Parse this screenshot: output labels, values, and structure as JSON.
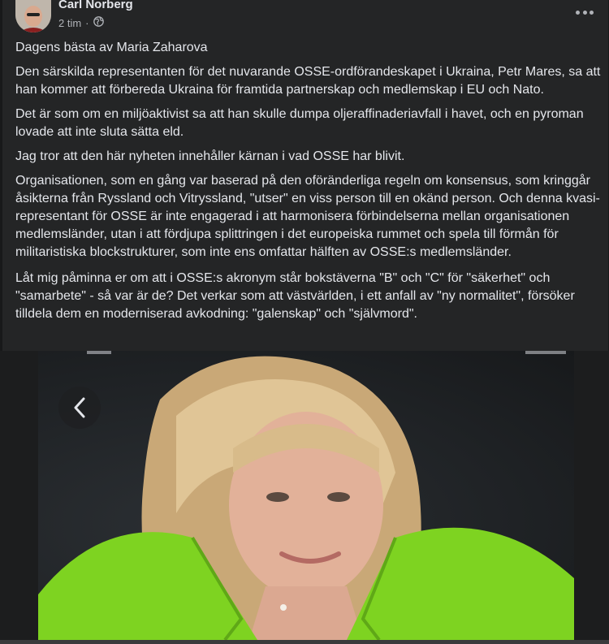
{
  "post": {
    "author": "Carl Norberg",
    "time": "2 tim",
    "separator": "·",
    "privacy_icon": "globe-icon",
    "more_icon": "more-options-icon",
    "paragraphs": [
      "Dagens bästa av Maria Zaharova",
      "Den särskilda representanten för det nuvarande OSSE-ordförandeskapet i Ukraina, Petr Mares, sa att han kommer att förbereda Ukraina för framtida partnerskap och medlemskap i EU och Nato.",
      "Det är som om en miljöaktivist sa att han skulle dumpa oljeraffinaderiavfall i havet, och en pyroman lovade att inte sluta sätta eld.",
      "Jag tror att den här nyheten innehåller kärnan i vad OSSE har blivit.",
      "Organisationen, som en gång var baserad på den oföränderliga regeln om konsensus, som kringgår åsikterna från Ryssland och Vitryssland, \"utser\" en viss person till en okänd person. Och denna kvasi-representant för OSSE är inte engagerad i att harmonisera förbindelserna mellan organisationen medlemsländer, utan i att fördjupa splittringen i det europeiska rummet och spela till förmån för militaristiska blockstrukturer, som inte ens omfattar hälften av OSSE:s medlemsländer.",
      "Låt mig påminna er om att i OSSE:s akronym står bokstäverna \"B\" och \"C\" för \"säkerhet\" och \"samarbete\" - så var är de? Det verkar som att västvärlden, i ett anfall av \"ny normalitet\", försöker tilldela dem en moderniserad avkodning: \"galenskap\" och \"självmord\"."
    ]
  },
  "media": {
    "back_icon": "chevron-left-icon",
    "accent_color": "#7ed321"
  }
}
